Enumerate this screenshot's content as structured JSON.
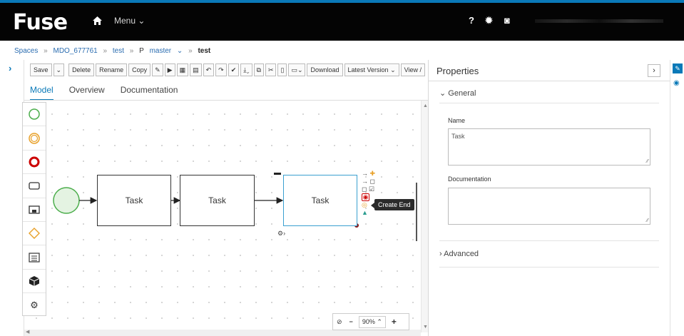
{
  "header": {
    "logo": "Fuse",
    "menu_label": "Menu",
    "help_icon": "?"
  },
  "breadcrumb": {
    "spaces": "Spaces",
    "org": "MDO_677761",
    "project": "test",
    "branch_prefix": "P",
    "branch": "master",
    "asset": "test"
  },
  "toolbar": {
    "save": "Save",
    "delete": "Delete",
    "rename": "Rename",
    "copy": "Copy",
    "download": "Download",
    "latest_version": "Latest Version",
    "view": "View /"
  },
  "tabs": [
    "Model",
    "Overview",
    "Documentation"
  ],
  "diagram": {
    "task1": "Task",
    "task2": "Task",
    "task3": "Task",
    "tooltip": "Create End"
  },
  "zoom": {
    "value": "90%",
    "minus": "−",
    "plus": "+"
  },
  "properties": {
    "title": "Properties",
    "toggle": "›",
    "general": "General",
    "name_label": "Name",
    "name_value": "Task",
    "doc_label": "Documentation",
    "doc_value": "",
    "advanced": "Advanced"
  },
  "colors": {
    "accent": "#0a79b8",
    "start_event": "#4cae4c",
    "intermediate_event": "#e8a028",
    "end_event": "#cc0000",
    "selected_task": "#3aa0d0"
  }
}
